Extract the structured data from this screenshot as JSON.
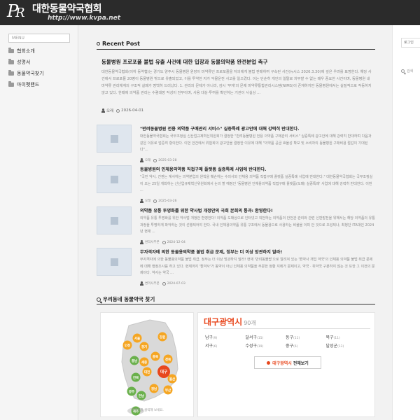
{
  "header": {
    "logo_mark": "P",
    "logo_mark_r": "R",
    "title": "대한동물약국협회",
    "url": "http://www.kvpa.net"
  },
  "sidebar": {
    "menu_label": "MENU",
    "items": [
      {
        "label": "협회소개",
        "icon": "folder-icon"
      },
      {
        "label": "성명서",
        "icon": "folder-icon"
      },
      {
        "label": "동물약국찾기",
        "icon": "folder-icon"
      },
      {
        "label": "마이펫랜드",
        "icon": "folder-icon"
      }
    ]
  },
  "recent": {
    "heading": "Recent Post",
    "featured": {
      "title": "동물병원 프로포폴 불법 유출 사건에 대한 입장과 동물의약품 완전분업 촉구",
      "body": "대한동물약국협회(이하 동약협)는 경기도 양주시 동물병원 원장이 마약류인 프로포폴을 자의에게 불법 판매하여 구속된 사건(뉴시스 2026.3.30)에 깊은 우려를 표명한다. 해당 사건에서 프로포폴 20병이 동물병원 밖으로 유출되었고, 이를 투약한 자가 악물운전 사고를 일으켰다. 이는 단순히 개인의 일탈로 치부할 수 없는 매우 중요한 사건이며, 동물병원 내 마약류 관리체계의 구조적 실패가 명백히 드러났다. 1. 관리의 문제가 아니라, 감시 '부재'의 문제 마약류통합관리시스템(NIMS)이 존재하지만 동물병원에서는 실질적으로 작동하지 않고 있다. 한때에 의약품 관리는 수렴대장 작성이 전부이며, 사용 대상·투여를 확인하는 기관이 사실상 ...",
      "author": "오래",
      "date": "2026-04-01"
    },
    "posts": [
      {
        "title": "\"반려동물병원 전용 의약품 구매관리 서비스\" 실증특례 광고안에 대해 강력히 반대한다.",
        "body": "대한동물약국협회는 국무조정실 신산업규제혁신위원회가 결정한 \"반려동물병원 전용 의약품 구매관리 서비스\" 실증특례 광고안에 대해 강력히 반대하며 다음과 같은 이유로 엄중히 항의한다. 이번 안건에서 위험회의 광고안을 결정한 이유에 대해 \"의약품 공급 효율성 확보 및 소비자의 동물병원 구매비용 절감이 기대된다\"...",
        "author": "오래",
        "date": "2025-03-28"
      },
      {
        "title": "동물병원의 인체용의약품 직접구매 플랫폼 실증특례 사업에 반대한다.",
        "body": "\"국민 약사, 간판는 계사하는 의약분업의 원칙을 훼손하는 수의사와 인체용 의약품 직접구매 플랫폼 실증특례 사업에 반대한다.\" 대한동물약국협회는 국무조정실이 오는 25일 개최하는 신산업규제혁신위원회에서 논의 할 예정인 '동물병원 인체용의약품 직접구매 플랫폼(도매) 실증특례' 사업에 대해 강력히 반대한다. 이번 ...",
        "author": "오래",
        "date": "2025-03-26"
      },
      {
        "title": "의약품 유통 투명화를 위한 약사법 개정안의 국회 본회의 통과: 환영한다!",
        "body": "의약품 유통 투명화를 위한 약사법 개정안 환영한다! 의약품 도매상으로 인터넷고 직전하는 의약품의 안전관·관리와 관련 신판발전을 위해서는 해당 의약품의 유통과정을 투명하게 파악하는 것이 선행되어야 한다. 국내 인체용의약품 유통 구조에서 동물용으로 사용하는 비율을 이미 안 것으로 조성되나, 최청단 ITA대인 2024년 현재 ...",
        "author": "변리사무본",
        "date": "2024-12-04"
      },
      {
        "title": "무자격자에 의한 동물용의약품 불법 취급 문제, 정부는 더 이상 방관하지 말라!",
        "body": "무자격자에 의한 동물용의약품 불법 취급, 정부는 더 이상 방관하지 말라! 현재 '반려동물팝'으로 알려져 있는 '뭔약사 개입 약국'의 인체용 의약품 불법 취급 문제에 대해 행정조사를 하고 있다. 현재까지 '뭔약사'가 동약이 아닌 인체용 의약품을 주문한 정황 지에가 문제이고, 약국 · 위약국 구분하지 않는 것 또한 그 이전의 문제이다. 약사는 약국 ...",
        "author": "변리사무본",
        "date": "2024-07-03"
      }
    ]
  },
  "finder": {
    "heading": "우리동네 동물약국 찾기",
    "map_caption": "지역명을 클릭해 보세요.",
    "map_regions": [
      "서울",
      "인천",
      "경기",
      "강원",
      "충북",
      "충남",
      "세종",
      "대전",
      "경북",
      "대구",
      "전북",
      "울산",
      "광주",
      "부산",
      "경남",
      "전남",
      "제주"
    ],
    "selected_region": "대구광역시",
    "selected_count": "90개",
    "districts": [
      {
        "name": "남구",
        "count": "(9)"
      },
      {
        "name": "달서구",
        "count": "(15)"
      },
      {
        "name": "동구",
        "count": "(11)"
      },
      {
        "name": "북구",
        "count": "(11)"
      },
      {
        "name": "서구",
        "count": "(6)"
      },
      {
        "name": "수성구",
        "count": "(19)"
      },
      {
        "name": "중구",
        "count": "(6)"
      },
      {
        "name": "달성군",
        "count": "(13)"
      }
    ],
    "view_all_region": "대구광역시",
    "view_all_suffix": "전체보기"
  },
  "right": {
    "box_label": "로그인",
    "search_placeholder": "검색"
  },
  "colors": {
    "accent": "#e8471d",
    "header_bg": "#2b2b2b",
    "map_marker_orange": "#f5a623",
    "map_marker_green": "#6ab04c"
  }
}
